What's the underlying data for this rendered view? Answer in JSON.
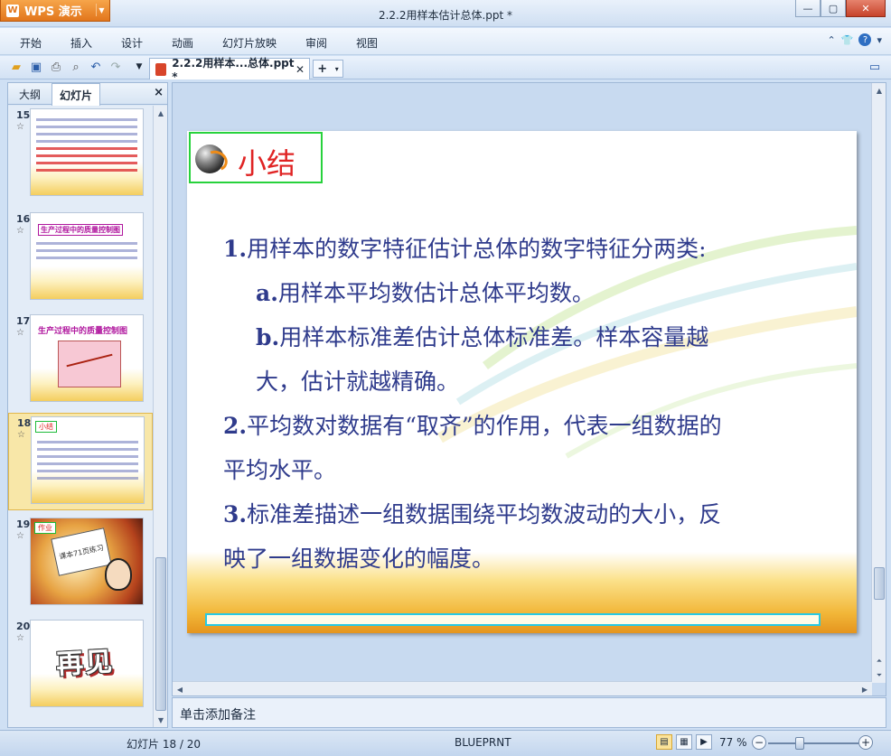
{
  "app": {
    "brand": "WPS 演示",
    "window_title": "2.2.2用样本估计总体.ppt *"
  },
  "menu": [
    "开始",
    "插入",
    "设计",
    "动画",
    "幻灯片放映",
    "审阅",
    "视图"
  ],
  "tab": {
    "label": "2.2.2用样本...总体.ppt *"
  },
  "pane": {
    "tabs": [
      "大纲",
      "幻灯片"
    ],
    "close": "×"
  },
  "thumbnails": [
    {
      "num": "15",
      "star": "☆"
    },
    {
      "num": "16",
      "star": "☆",
      "title": "生产过程中的质量控制图"
    },
    {
      "num": "17",
      "star": "☆",
      "title": "生产过程中的质量控制图"
    },
    {
      "num": "18",
      "star": "☆",
      "badge": "小结",
      "selected": true
    },
    {
      "num": "19",
      "star": "☆",
      "badge": "作业",
      "board": "课本71页练习"
    },
    {
      "num": "20",
      "star": "☆",
      "text": "再见"
    }
  ],
  "slide": {
    "title": "小结",
    "lines": [
      {
        "num": "1.",
        "text": "用样本的数字特征估计总体的数字特征分两类:"
      },
      {
        "num": "a.",
        "text": "用样本平均数估计总体平均数。"
      },
      {
        "num": "b.",
        "text": "用样本标准差估计总体标准差。样本容量越"
      },
      {
        "text": "大，估计就越精确。"
      },
      {
        "num": "2.",
        "text": "平均数对数据有“取齐”的作用，代表一组数据的"
      },
      {
        "text": "平均水平。"
      },
      {
        "num": "3.",
        "text": "标准差描述一组数据围绕平均数波动的大小，反"
      },
      {
        "text": "映了一组数据变化的幅度。"
      }
    ]
  },
  "notes": {
    "placeholder": "单击添加备注"
  },
  "status": {
    "slide_info": "幻灯片 18 / 20",
    "template": "BLUEPRNT",
    "zoom": "77 %"
  },
  "colors": {
    "slide_text": "#2f3b8c",
    "title_red": "#e02424",
    "title_border": "#27d23c",
    "accent_orange": "#e2761c"
  }
}
